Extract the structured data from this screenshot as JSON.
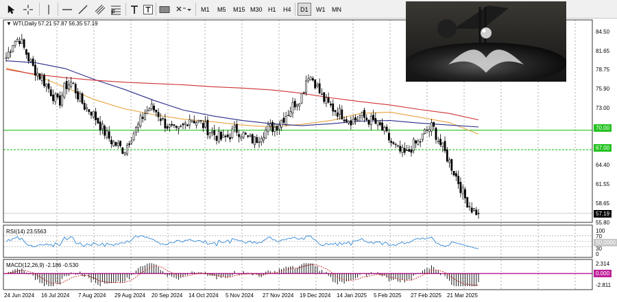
{
  "toolbar": {
    "tools": [
      {
        "name": "cursor-tool",
        "icon": "cursor-arrow-icon"
      },
      {
        "name": "crosshair-tool",
        "icon": "crosshair-icon"
      },
      {
        "name": "vertical-line-tool",
        "icon": "vertical-line-icon"
      },
      {
        "name": "horizontal-line-tool",
        "icon": "horizontal-line-icon"
      },
      {
        "name": "trendline-tool",
        "icon": "trendline-icon"
      },
      {
        "name": "channel-tool",
        "icon": "channel-icon"
      },
      {
        "name": "fibonacci-tool",
        "icon": "fibonacci-icon"
      },
      {
        "name": "text-tool",
        "icon": "text-icon"
      },
      {
        "name": "text-label-tool",
        "icon": "text-label-icon"
      },
      {
        "name": "rectangle-tool",
        "icon": "rectangle-icon"
      },
      {
        "name": "shapes-menu",
        "icon": "shapes-dropdown-icon"
      }
    ],
    "timeframes": [
      "M1",
      "M5",
      "M15",
      "M30",
      "H1",
      "H4",
      "D1",
      "W1",
      "MN"
    ],
    "active_timeframe": "D1"
  },
  "main_chart": {
    "header": "WTI,Daily  57.21 57.87 56.35 57.19",
    "price_ticks": [
      "84.50",
      "81.65",
      "78.75",
      "75.90",
      "73.00",
      "70.00",
      "67.00",
      "64.40",
      "61.55",
      "58.65",
      "57.19",
      "55.80"
    ],
    "current_price": "57.19",
    "horizontal_levels": [
      {
        "label": "70.00",
        "value": 70.0,
        "color": "#22c21e",
        "style": "solid"
      },
      {
        "label": "67.00",
        "value": 67.0,
        "color": "#22c21e",
        "style": "dashed"
      }
    ]
  },
  "rsi_pane": {
    "header": "RSI(14) 23.5563",
    "ticks": [
      "100",
      "70",
      "50.0000",
      "30",
      "0"
    ]
  },
  "macd_pane": {
    "header": "MACD(12,26,9) -2.186 -0.530",
    "ticks": [
      "2.314",
      "0.000",
      "-2.811"
    ]
  },
  "date_axis": [
    "24 Jun 2024",
    "16 Jul 2024",
    "7 Aug 2024",
    "29 Aug 2024",
    "20 Sep 2024",
    "14 Oct 2024",
    "5 Nov 2024",
    "27 Nov 2024",
    "19 Dec 2024",
    "14 Jan 2025",
    "5 Feb 2025",
    "27 Feb 2025",
    "21 Mar 2025"
  ],
  "colors": {
    "candle": "#000000",
    "ma_fast": "#e8a33c",
    "ma_mid": "#2a2a8a",
    "ma_slow": "#d03030",
    "level": "#22c21e",
    "rsi": "#2f86d6",
    "macd_signal": "#c02020",
    "macd_zero": "#c0209a"
  },
  "chart_data": {
    "type": "candlestick",
    "symbol": "WTI",
    "timeframe": "Daily",
    "ylim": [
      55.8,
      87.0
    ],
    "x": [
      "24 Jun 2024",
      "16 Jul 2024",
      "7 Aug 2024",
      "29 Aug 2024",
      "20 Sep 2024",
      "14 Oct 2024",
      "5 Nov 2024",
      "27 Nov 2024",
      "19 Dec 2024",
      "14 Jan 2025",
      "5 Feb 2025",
      "27 Feb 2025",
      "21 Mar 2025"
    ],
    "close_path": [
      81.2,
      83.5,
      84.2,
      82.0,
      79.8,
      78.5,
      77.2,
      75.6,
      74.0,
      76.8,
      77.4,
      75.2,
      73.6,
      72.9,
      71.3,
      69.7,
      68.4,
      67.6,
      66.9,
      69.0,
      70.4,
      72.5,
      73.6,
      72.8,
      71.2,
      70.3,
      69.6,
      70.6,
      72.0,
      71.4,
      70.8,
      69.9,
      69.2,
      68.5,
      69.2,
      70.2,
      69.5,
      68.6,
      68.4,
      69.6,
      70.3,
      70.5,
      71.6,
      72.8,
      74.2,
      75.3,
      78.7,
      77.6,
      75.3,
      74.0,
      73.2,
      72.6,
      71.8,
      71.5,
      72.2,
      71.7,
      71.3,
      70.5,
      69.2,
      67.6,
      66.7,
      66.2,
      67.7,
      68.2,
      69.9,
      70.6,
      68.2,
      66.3,
      64.2,
      61.9,
      59.4,
      57.9,
      57.19
    ],
    "final_ohlc": {
      "open": 57.21,
      "high": 57.87,
      "low": 56.35,
      "close": 57.19
    },
    "moving_averages": [
      {
        "color": "#e8a33c",
        "y": [
          79.6,
          78.5,
          76.6,
          74.7,
          73.3,
          72.4,
          71.7,
          71.3,
          70.8,
          70.5,
          70.9,
          71.5,
          72.6,
          72.8,
          72.0,
          71.2,
          69.4
        ]
      },
      {
        "color": "#2a2a8a",
        "y": [
          80.7,
          80.4,
          79.5,
          77.8,
          76.3,
          74.6,
          73.1,
          72.2,
          71.5,
          71.0,
          70.7,
          71.0,
          71.4,
          71.5,
          71.1,
          70.8,
          70.5
        ]
      },
      {
        "color": "#d03030",
        "y": [
          79.4,
          78.6,
          78.1,
          77.7,
          77.4,
          77.2,
          77.0,
          76.7,
          76.5,
          76.2,
          75.7,
          75.0,
          74.4,
          73.9,
          73.2,
          72.6,
          71.6
        ]
      }
    ],
    "levels": [
      70.0,
      67.0
    ],
    "rsi": {
      "period": 14,
      "last": 23.5563,
      "ylim": [
        0,
        100
      ],
      "levels": [
        30,
        50,
        70
      ]
    },
    "macd": {
      "fast": 12,
      "slow": 26,
      "signal": 9,
      "main": -2.186,
      "signal_value": -0.53,
      "ticks": [
        2.314,
        0.0,
        -2.811
      ]
    }
  }
}
